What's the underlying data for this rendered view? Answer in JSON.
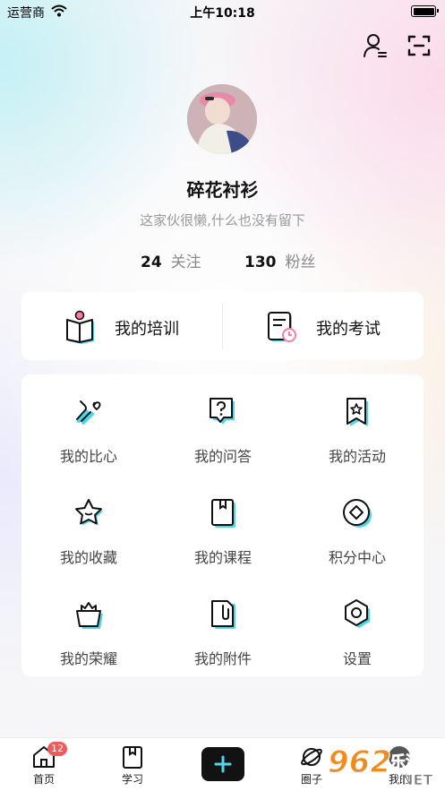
{
  "status_bar": {
    "carrier": "运营商",
    "time": "上午10:18"
  },
  "header": {
    "profile_icon": "user-list-icon",
    "scan_icon": "scan-icon"
  },
  "profile": {
    "name": "碎花衬衫",
    "bio": "这家伙很懒,什么也没有留下",
    "following_count": "24",
    "following_label": "关注",
    "fans_count": "130",
    "fans_label": "粉丝"
  },
  "quick_links": [
    {
      "label": "我的培训",
      "icon": "book-icon"
    },
    {
      "label": "我的考试",
      "icon": "exam-paper-icon"
    }
  ],
  "menu_items": [
    {
      "label": "我的比心",
      "icon": "finger-heart-icon"
    },
    {
      "label": "我的问答",
      "icon": "question-bubble-icon"
    },
    {
      "label": "我的活动",
      "icon": "activity-flag-icon"
    },
    {
      "label": "我的收藏",
      "icon": "star-icon"
    },
    {
      "label": "我的课程",
      "icon": "course-book-icon"
    },
    {
      "label": "积分中心",
      "icon": "points-diamond-icon"
    },
    {
      "label": "我的荣耀",
      "icon": "crown-basket-icon"
    },
    {
      "label": "我的附件",
      "icon": "attachment-icon"
    },
    {
      "label": "设置",
      "icon": "settings-hexagon-icon"
    }
  ],
  "tabbar": {
    "home": {
      "label": "首页",
      "badge": "12"
    },
    "study": {
      "label": "学习"
    },
    "circle": {
      "label": "圈子"
    },
    "me": {
      "label": "我的"
    }
  },
  "watermark": {
    "text": "962",
    "sub": "乐游网",
    "tld": ".NET"
  },
  "colors": {
    "accent_cyan": "#4fd6e8",
    "badge_red": "#f05a5a",
    "plus_button": "#121212"
  }
}
